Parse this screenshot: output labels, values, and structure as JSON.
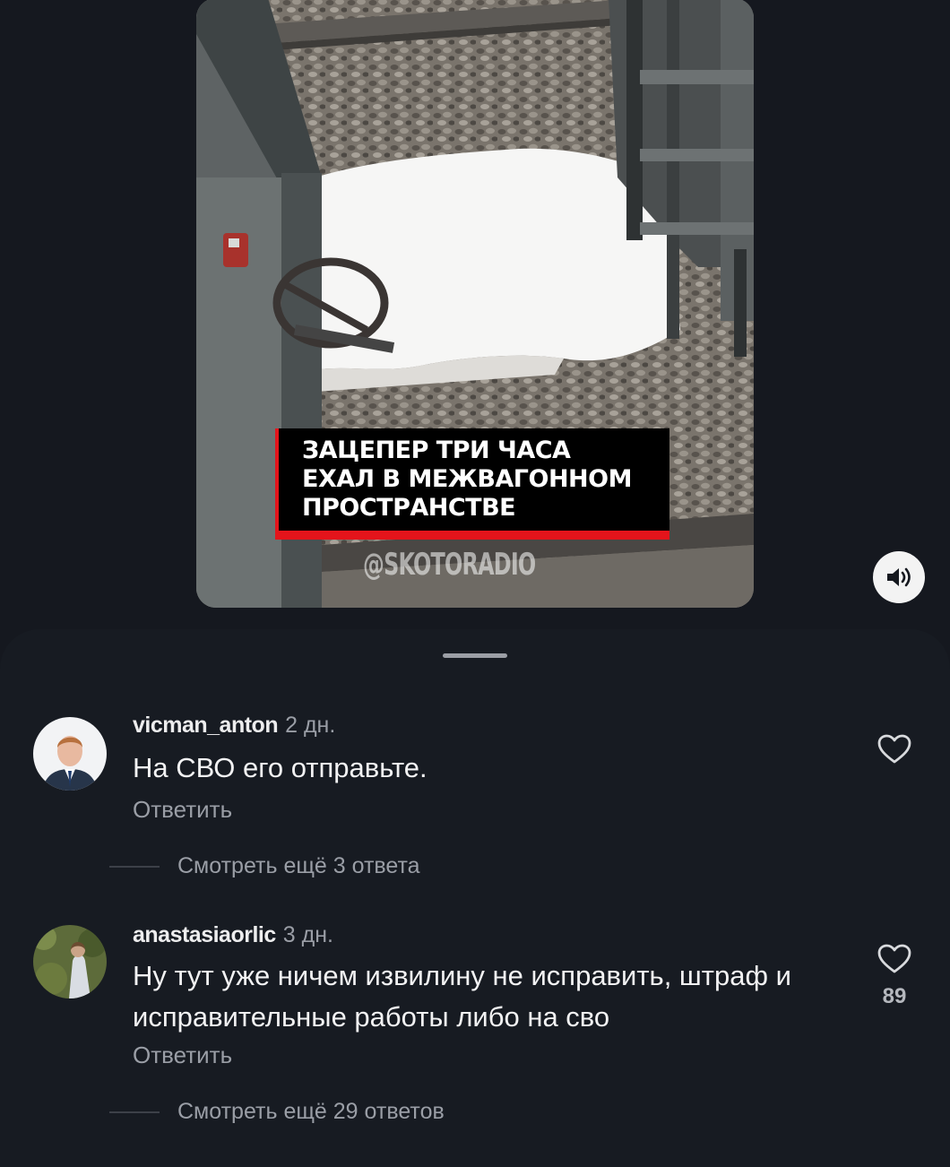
{
  "video": {
    "caption_lines": [
      "ЗАЦЕПЕР ТРИ ЧАСА",
      "ЕХАЛ В МЕЖВАГОННОМ",
      "ПРОСТРАНСТВЕ"
    ],
    "watermark": "@SKOTORADIO",
    "sound_icon": "speaker-icon"
  },
  "comments": [
    {
      "username": "vicman_anton",
      "time": "2 дн.",
      "text": "На СВО его отправьте.",
      "reply_label": "Ответить",
      "likes": "",
      "more_replies": "Смотреть ещё 3 ответа"
    },
    {
      "username": "anastasiaorlic",
      "time": "3 дн.",
      "text": "Ну тут уже ничем извилину не исправить, штраф и исправительные работы либо на сво",
      "reply_label": "Ответить",
      "likes": "89",
      "more_replies": "Смотреть ещё 29 ответов"
    }
  ],
  "colors": {
    "background": "#15181f",
    "sheet": "#171b22",
    "caption_red": "#e4141b"
  }
}
